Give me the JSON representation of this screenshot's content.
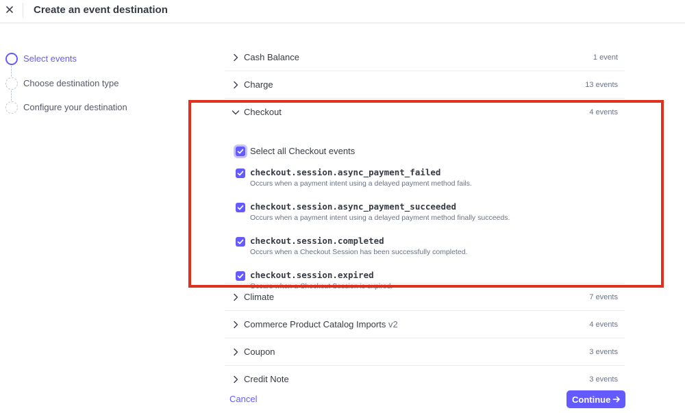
{
  "header": {
    "title": "Create an event destination"
  },
  "stepper": {
    "steps": [
      {
        "label": "Select events",
        "state": "active"
      },
      {
        "label": "Choose destination type",
        "state": "inactive"
      },
      {
        "label": "Configure your destination",
        "state": "inactive"
      }
    ]
  },
  "events": {
    "before": [
      {
        "name": "Cash Balance",
        "count": "1 event"
      },
      {
        "name": "Charge",
        "count": "13 events"
      }
    ],
    "expanded": {
      "name": "Checkout",
      "count": "4 events",
      "select_all_label": "Select all Checkout events",
      "select_all_checked": true,
      "items": [
        {
          "name": "checkout.session.async_payment_failed",
          "description": "Occurs when a payment intent using a delayed payment method fails.",
          "checked": true
        },
        {
          "name": "checkout.session.async_payment_succeeded",
          "description": "Occurs when a payment intent using a delayed payment method finally succeeds.",
          "checked": true
        },
        {
          "name": "checkout.session.completed",
          "description": "Occurs when a Checkout Session has been successfully completed.",
          "checked": true
        },
        {
          "name": "checkout.session.expired",
          "description": "Occurs when a Checkout Session is expired.",
          "checked": true
        }
      ]
    },
    "after": [
      {
        "name": "Climate",
        "version": "",
        "count": "7 events"
      },
      {
        "name": "Commerce Product Catalog Imports",
        "version": "v2",
        "count": "4 events"
      },
      {
        "name": "Coupon",
        "version": "",
        "count": "3 events"
      },
      {
        "name": "Credit Note",
        "version": "",
        "count": "3 events"
      }
    ]
  },
  "footer": {
    "cancel_label": "Cancel",
    "continue_label": "Continue"
  },
  "colors": {
    "accent": "#635bff",
    "highlight": "#e0301e"
  },
  "icons": [
    "close-icon",
    "chevron-right-icon",
    "chevron-down-icon",
    "checkmark-icon",
    "arrow-right-icon"
  ]
}
